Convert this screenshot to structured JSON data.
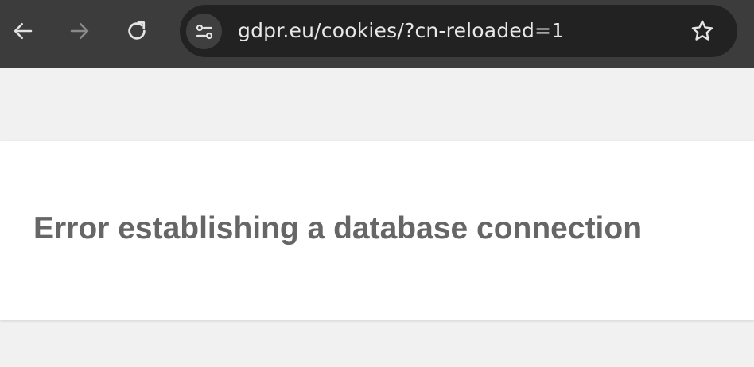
{
  "browser": {
    "back_icon": "arrow-left-icon",
    "forward_icon": "arrow-right-icon",
    "reload_icon": "reload-icon",
    "site_info_icon": "tune-icon",
    "bookmark_icon": "star-outline-icon",
    "url": "gdpr.eu/cookies/?cn-reloaded=1"
  },
  "page": {
    "error_title": "Error establishing a database connection"
  },
  "colors": {
    "toolbar": "#3c3c3c",
    "omnibox": "#222222",
    "page_background": "#f1f1f1",
    "card": "#ffffff",
    "heading": "#666666"
  }
}
